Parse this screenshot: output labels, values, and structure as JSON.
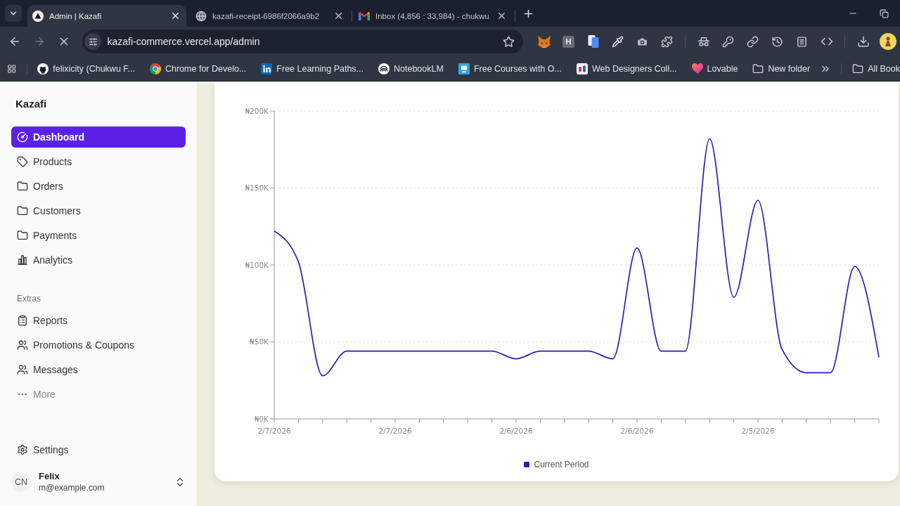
{
  "browser": {
    "tabs": [
      {
        "title": "Admin | Kazafi",
        "selected": true
      },
      {
        "title": "kazafi-receipt-6986f2066a9b2",
        "selected": false
      },
      {
        "title": "Inbox (4,856 : 33,984) - chukwu",
        "selected": false
      }
    ],
    "loading": true,
    "forward_disabled": true,
    "address": "kazafi-commerce.vercel.app/admin",
    "extension_label": "H",
    "bookmarks": [
      {
        "label": "felixicity (Chukwu F...",
        "kind": "site"
      },
      {
        "label": "Chrome for Develo...",
        "kind": "site"
      },
      {
        "label": "Free Learning Paths...",
        "kind": "site"
      },
      {
        "label": "NotebookLM",
        "kind": "site"
      },
      {
        "label": "Free Courses with O...",
        "kind": "site"
      },
      {
        "label": "Web Designers Coll...",
        "kind": "site"
      },
      {
        "label": "Lovable",
        "kind": "site"
      },
      {
        "label": "New folder",
        "kind": "folder"
      }
    ],
    "all_bookmarks": "All Book"
  },
  "sidebar": {
    "brand": "Kazafi",
    "nav": [
      {
        "label": "Dashboard",
        "selected": true
      },
      {
        "label": "Products",
        "selected": false
      },
      {
        "label": "Orders",
        "selected": false
      },
      {
        "label": "Customers",
        "selected": false
      },
      {
        "label": "Payments",
        "selected": false
      },
      {
        "label": "Analytics",
        "selected": false
      }
    ],
    "extras": {
      "title": "Extras",
      "items": [
        {
          "label": "Reports",
          "selected": false,
          "muted": false
        },
        {
          "label": "Promotions & Coupons",
          "selected": false,
          "muted": false
        },
        {
          "label": "Messages",
          "selected": false,
          "muted": false
        },
        {
          "label": "More",
          "selected": false,
          "muted": true
        }
      ]
    },
    "settings": {
      "label": "Settings",
      "selected": false
    },
    "user": {
      "initials": "CN",
      "name": "Felix",
      "email": "m@example.com"
    }
  },
  "chart_card": {
    "chart_data": {
      "type": "line",
      "categories": [
        "2/7/2026",
        null,
        null,
        null,
        null,
        "2/7/2026",
        null,
        null,
        null,
        null,
        "2/6/2026",
        null,
        null,
        null,
        null,
        "2/6/2026",
        null,
        null,
        null,
        null,
        "2/5/2026",
        null,
        null,
        null,
        null,
        null
      ],
      "series": [
        {
          "name": "Current Period",
          "color": "#2a1fb0",
          "values": [
            122000,
            102000,
            28000,
            44000,
            44000,
            44000,
            44000,
            44000,
            44000,
            44000,
            39000,
            44000,
            44000,
            44000,
            39000,
            111000,
            44000,
            44000,
            182000,
            79000,
            142000,
            45000,
            30000,
            30000,
            99000,
            40000
          ]
        }
      ],
      "ylim": [
        0,
        200000
      ],
      "yticks": [
        {
          "value": 0,
          "label": "₦0K"
        },
        {
          "value": 50000,
          "label": "₦50K"
        },
        {
          "value": 100000,
          "label": "₦100K"
        },
        {
          "value": 150000,
          "label": "₦150K"
        },
        {
          "value": 200000,
          "label": "₦200K"
        }
      ],
      "grid": true,
      "legend": "bottom"
    }
  }
}
